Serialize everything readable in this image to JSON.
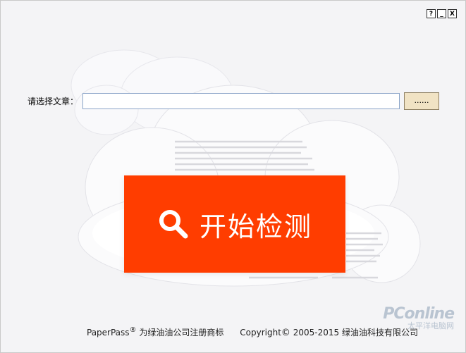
{
  "window": {
    "help_label": "?",
    "minimize_label": "_",
    "close_label": "X"
  },
  "form": {
    "select_article_label": "请选择文章：",
    "path_value": "",
    "browse_label": "......"
  },
  "action": {
    "start_label": "开始检测"
  },
  "footer": {
    "brand": "PaperPass",
    "registered": "®",
    "trademark_text": " 为绿油油公司注册商标",
    "copyright_word": "Copyright",
    "copyright_symbol": "©",
    "copyright_text": " 2005-2015 绿油油科技有限公司"
  },
  "watermark": {
    "main": "PConline",
    "sub": "太平洋电脑网"
  },
  "colors": {
    "accent": "#ff3d00",
    "background": "#f4f4f6",
    "browse_bg": "#f1e3c4"
  }
}
